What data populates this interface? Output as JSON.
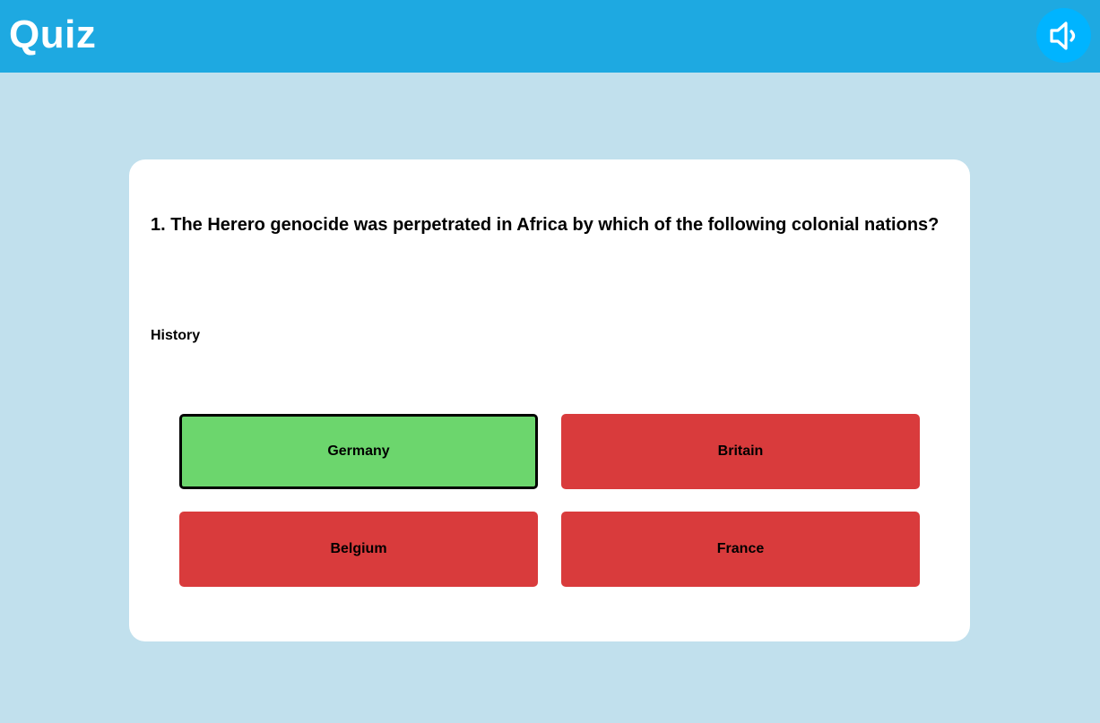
{
  "header": {
    "title": "Quiz",
    "sound_icon": "speaker-icon",
    "bar_color": "#1ea9e1",
    "sound_button_color": "#00b4ff"
  },
  "quiz": {
    "question": "1. The Herero genocide was perpetrated in Africa by which of the following colonial nations?",
    "category": "History",
    "answers": [
      {
        "label": "Germany",
        "state": "correct",
        "color": "#6cd66d"
      },
      {
        "label": "Britain",
        "state": "incorrect",
        "color": "#d93b3c"
      },
      {
        "label": "Belgium",
        "state": "incorrect",
        "color": "#d93b3c"
      },
      {
        "label": "France",
        "state": "incorrect",
        "color": "#d93b3c"
      }
    ]
  },
  "colors": {
    "page_background": "#c1e0ed",
    "card_background": "#ffffff"
  }
}
